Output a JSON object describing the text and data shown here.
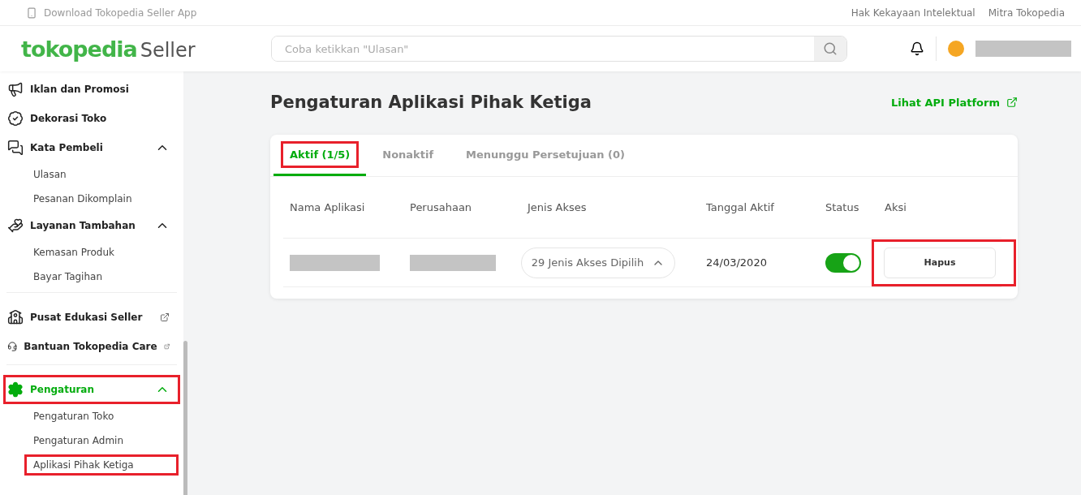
{
  "top_bar": {
    "download_link": "Download Tokopedia Seller App",
    "links": [
      "Hak Kekayaan Intelektual",
      "Mitra Tokopedia"
    ]
  },
  "header": {
    "logo_brand": "tokopedia",
    "logo_suffix": "Seller",
    "search": {
      "placeholder": "Coba ketikkan \"Ulasan\""
    }
  },
  "sidebar": {
    "sections": [
      {
        "items": [
          {
            "label": "Iklan dan Promosi",
            "active": false,
            "external": false,
            "highlighted": false
          },
          {
            "label": "Dekorasi Toko",
            "active": false,
            "external": false,
            "highlighted": false
          },
          {
            "label": "Kata Pembeli",
            "active": false,
            "external": false,
            "highlighted": false,
            "expanded": true,
            "children": [
              {
                "label": "Ulasan",
                "highlighted": false
              },
              {
                "label": "Pesanan Dikomplain",
                "highlighted": false
              }
            ]
          },
          {
            "label": "Layanan Tambahan",
            "active": false,
            "external": false,
            "highlighted": false,
            "expanded": true,
            "children": [
              {
                "label": "Kemasan Produk",
                "highlighted": false
              },
              {
                "label": "Bayar Tagihan",
                "highlighted": false
              }
            ]
          }
        ]
      },
      {
        "items": [
          {
            "label": "Pusat Edukasi Seller",
            "active": false,
            "external": true,
            "highlighted": false
          },
          {
            "label": "Bantuan Tokopedia Care",
            "active": false,
            "external": true,
            "highlighted": false
          }
        ]
      },
      {
        "items": [
          {
            "label": "Pengaturan",
            "active": true,
            "external": false,
            "highlighted": true,
            "expanded": true,
            "children": [
              {
                "label": "Pengaturan Toko",
                "highlighted": false
              },
              {
                "label": "Pengaturan Admin",
                "highlighted": false
              },
              {
                "label": "Aplikasi Pihak Ketiga",
                "highlighted": true
              }
            ]
          }
        ]
      }
    ]
  },
  "page": {
    "title": "Pengaturan Aplikasi Pihak Ketiga",
    "api_link": "Lihat API Platform",
    "tabs": [
      {
        "label": "Aktif (1/5)",
        "selected": true,
        "highlighted": true
      },
      {
        "label": "Nonaktif",
        "selected": false,
        "highlighted": false
      },
      {
        "label": "Menunggu Persetujuan (0)",
        "selected": false,
        "highlighted": false
      }
    ],
    "table": {
      "columns": [
        "Nama Aplikasi",
        "Perusahaan",
        "Jenis Akses",
        "Tanggal Aktif",
        "Status",
        "Aksi"
      ],
      "rows": [
        {
          "access": "29 Jenis Akses Dipilih",
          "access_expanded": true,
          "date": "24/03/2020",
          "status_on": true,
          "action": "Hapus",
          "action_highlighted": true
        }
      ]
    }
  }
}
